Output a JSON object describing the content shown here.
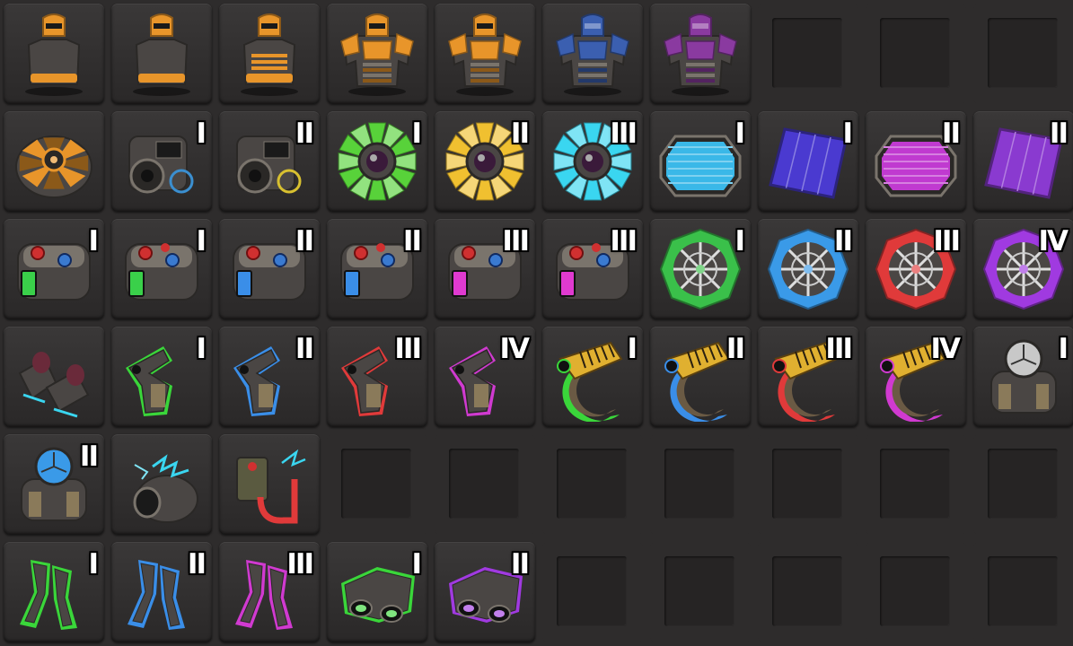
{
  "inventory": {
    "slots": [
      {
        "item": "armor-light-icon",
        "color": "#e8952a",
        "tier": ""
      },
      {
        "item": "armor-light-visor-icon",
        "color": "#e8952a",
        "tier": ""
      },
      {
        "item": "armor-heavy-icon",
        "color": "#e8952a",
        "tier": ""
      },
      {
        "item": "armor-modular-icon",
        "color": "#e8952a",
        "tier": ""
      },
      {
        "item": "armor-power-icon",
        "color": "#e8952a",
        "tier": ""
      },
      {
        "item": "armor-power-mk2-icon",
        "color": "#3b5fb0",
        "tier": ""
      },
      {
        "item": "armor-power-mk3-icon",
        "color": "#8a3aa0",
        "tier": ""
      },
      {
        "item": "empty",
        "color": "",
        "tier": ""
      },
      {
        "item": "empty",
        "color": "",
        "tier": ""
      },
      {
        "item": "empty",
        "color": "",
        "tier": ""
      },
      {
        "item": "fusion-reactor-equipment-icon",
        "color": "#e8952a",
        "tier": ""
      },
      {
        "item": "portable-generator-icon",
        "color": "#3b8fd0",
        "tier": "I"
      },
      {
        "item": "portable-generator-icon",
        "color": "#d8c030",
        "tier": "II"
      },
      {
        "item": "fusion-core-icon",
        "color": "#58d23a",
        "tier": "I"
      },
      {
        "item": "fusion-core-icon",
        "color": "#f0c030",
        "tier": "II"
      },
      {
        "item": "fusion-core-icon",
        "color": "#3ad6f0",
        "tier": "III"
      },
      {
        "item": "solar-panel-equipment-icon",
        "color": "#3ab8e8",
        "tier": "I"
      },
      {
        "item": "solar-panel-mk2-icon",
        "color": "#4a3ad0",
        "tier": "I"
      },
      {
        "item": "solar-panel-equipment-icon",
        "color": "#c03ad0",
        "tier": "II"
      },
      {
        "item": "solar-panel-mk2-icon",
        "color": "#8a3ad0",
        "tier": "II"
      },
      {
        "item": "battery-equipment-icon",
        "color": "#3ad04a",
        "tier": "I"
      },
      {
        "item": "battery-mk2-icon",
        "color": "#3ad04a",
        "tier": "I"
      },
      {
        "item": "battery-equipment-icon",
        "color": "#3a8ee8",
        "tier": "II"
      },
      {
        "item": "battery-mk2-icon",
        "color": "#3a8ee8",
        "tier": "II"
      },
      {
        "item": "battery-equipment-icon",
        "color": "#e03ad0",
        "tier": "III"
      },
      {
        "item": "battery-mk2-icon",
        "color": "#e03ad0",
        "tier": "III"
      },
      {
        "item": "energy-shield-icon",
        "color": "#3ac04a",
        "tier": "I"
      },
      {
        "item": "energy-shield-icon",
        "color": "#3a9ae8",
        "tier": "II"
      },
      {
        "item": "energy-shield-icon",
        "color": "#e03a3a",
        "tier": "III"
      },
      {
        "item": "energy-shield-icon",
        "color": "#a03ae0",
        "tier": "IV"
      },
      {
        "item": "exoskeleton-legs-icon",
        "color": "#3ad6f0",
        "tier": ""
      },
      {
        "item": "personal-laser-defense-icon",
        "color": "#3ad63a",
        "tier": "I"
      },
      {
        "item": "personal-laser-defense-icon",
        "color": "#3a8ee8",
        "tier": "II"
      },
      {
        "item": "personal-laser-defense-icon",
        "color": "#e03a3a",
        "tier": "III"
      },
      {
        "item": "personal-laser-defense-icon",
        "color": "#d03ad0",
        "tier": "IV"
      },
      {
        "item": "heavy-laser-turret-icon",
        "color": "#3ad63a",
        "tier": "I"
      },
      {
        "item": "heavy-laser-turret-icon",
        "color": "#3a8ee8",
        "tier": "II"
      },
      {
        "item": "heavy-laser-turret-icon",
        "color": "#e03a3a",
        "tier": "III"
      },
      {
        "item": "heavy-laser-turret-icon",
        "color": "#d03ad0",
        "tier": "IV"
      },
      {
        "item": "roboport-equipment-icon",
        "color": "#c8c8c8",
        "tier": "I"
      },
      {
        "item": "roboport-equipment-icon",
        "color": "#3a9ae8",
        "tier": "II"
      },
      {
        "item": "discharge-defense-icon",
        "color": "#3ad6f0",
        "tier": ""
      },
      {
        "item": "discharge-remote-icon",
        "color": "#e03a3a",
        "tier": ""
      },
      {
        "item": "empty",
        "color": "",
        "tier": ""
      },
      {
        "item": "empty",
        "color": "",
        "tier": ""
      },
      {
        "item": "empty",
        "color": "",
        "tier": ""
      },
      {
        "item": "empty",
        "color": "",
        "tier": ""
      },
      {
        "item": "empty",
        "color": "",
        "tier": ""
      },
      {
        "item": "empty",
        "color": "",
        "tier": ""
      },
      {
        "item": "empty",
        "color": "",
        "tier": ""
      },
      {
        "item": "exoskeleton-equipment-icon",
        "color": "#3ad63a",
        "tier": "I"
      },
      {
        "item": "exoskeleton-equipment-icon",
        "color": "#3a8ee8",
        "tier": "II"
      },
      {
        "item": "exoskeleton-equipment-icon",
        "color": "#d03ad0",
        "tier": "III"
      },
      {
        "item": "night-vision-icon",
        "color": "#3ad63a",
        "tier": "I"
      },
      {
        "item": "night-vision-icon",
        "color": "#a03ae0",
        "tier": "II"
      },
      {
        "item": "empty",
        "color": "",
        "tier": ""
      },
      {
        "item": "empty",
        "color": "",
        "tier": ""
      },
      {
        "item": "empty",
        "color": "",
        "tier": ""
      },
      {
        "item": "empty",
        "color": "",
        "tier": ""
      },
      {
        "item": "empty",
        "color": "",
        "tier": ""
      }
    ]
  }
}
